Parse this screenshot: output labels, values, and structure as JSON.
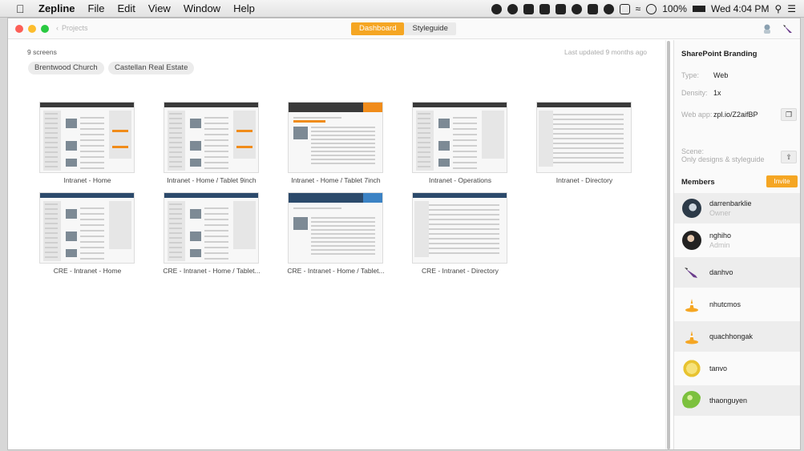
{
  "menubar": {
    "app_name": "Zepline",
    "items": [
      "File",
      "Edit",
      "View",
      "Window",
      "Help"
    ],
    "battery": "100%",
    "clock": "Wed 4:04 PM"
  },
  "toolbar": {
    "back_label": "Projects",
    "tabs": [
      {
        "label": "Dashboard",
        "active": true
      },
      {
        "label": "Styleguide",
        "active": false
      }
    ]
  },
  "dashboard": {
    "screen_count": "9 screens",
    "last_updated": "Last updated 9 months ago",
    "tags": [
      "Brentwood Church",
      "Castellan Real Estate"
    ],
    "screens": [
      {
        "caption": "Intranet - Home",
        "style": "light"
      },
      {
        "caption": "Intranet - Home / Tablet 9inch",
        "style": "light"
      },
      {
        "caption": "Intranet - Home / Tablet 7inch",
        "style": "orange"
      },
      {
        "caption": "Intranet - Operations",
        "style": "light"
      },
      {
        "caption": "Intranet - Directory",
        "style": "table"
      },
      {
        "caption": "CRE - Intranet - Home",
        "style": "blue"
      },
      {
        "caption": "CRE - Intranet - Home / Tablet...",
        "style": "blue"
      },
      {
        "caption": "CRE - Intranet - Home / Tablet...",
        "style": "blue2"
      },
      {
        "caption": "CRE - Intranet - Directory",
        "style": "table-blue"
      }
    ]
  },
  "sidebar": {
    "project_name": "SharePoint Branding",
    "type_label": "Type:",
    "type_value": "Web",
    "density_label": "Density:",
    "density_value": "1x",
    "webapp_label": "Web app:",
    "webapp_value": "zpl.io/Z2aifBP",
    "scene_label": "Scene:",
    "scene_value": "Only designs & styleguide",
    "members_title": "Members",
    "invite_label": "Invite",
    "members": [
      {
        "name": "darrenbarklie",
        "role": "Owner",
        "avatar": "photo-dark",
        "shaded": true
      },
      {
        "name": "nghiho",
        "role": "Admin",
        "avatar": "photo-person",
        "shaded": false
      },
      {
        "name": "danhvo",
        "role": "",
        "avatar": "purple-brush-icon",
        "shaded": true
      },
      {
        "name": "nhutcmos",
        "role": "",
        "avatar": "cone-icon",
        "shaded": false
      },
      {
        "name": "quachhongak",
        "role": "",
        "avatar": "cone-icon",
        "shaded": true
      },
      {
        "name": "tanvo",
        "role": "",
        "avatar": "yellow-circle-icon",
        "shaded": false
      },
      {
        "name": "thaonguyen",
        "role": "",
        "avatar": "green-ball-icon",
        "shaded": true
      }
    ]
  },
  "colors": {
    "accent": "#f5a623",
    "thumb_orange": "#f08c1a",
    "thumb_navy": "#2c4a6b"
  }
}
